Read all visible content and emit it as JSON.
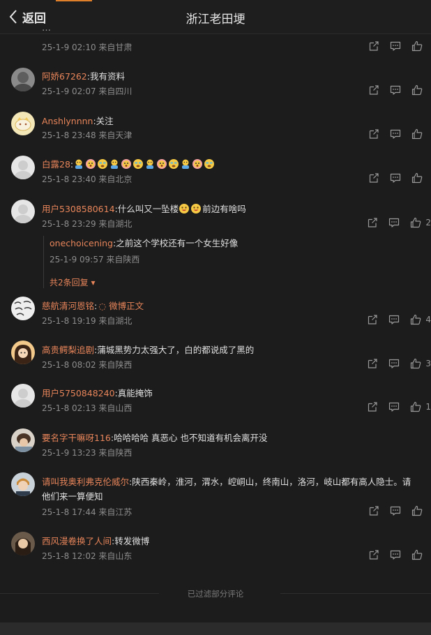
{
  "header": {
    "back_label": "返回",
    "title": "浙江老田埂"
  },
  "partial_top": {
    "text": "…"
  },
  "comments": [
    {
      "meta": "25-1-9 02:10 来自甘肃",
      "like_count": ""
    },
    {
      "user": "阿娇67262",
      "text": ":我有资料",
      "meta": "25-1-9 02:07 来自四川",
      "like_count": ""
    },
    {
      "user": "Anshlynnnn",
      "text": ":关注",
      "meta": "25-1-8 23:48 来自天津",
      "like_count": ""
    },
    {
      "user": "白露28",
      "text": ":",
      "meta": "25-1-8 23:40 来自北京",
      "like_count": ""
    },
    {
      "user": "用户5308580614",
      "text": ":什么叫又一坠楼",
      "text2": "前边有啥吗",
      "meta": "25-1-8 23:29 来自湖北",
      "like_count": "2",
      "reply": {
        "user": "onechoicening",
        "text": ":之前这个学校还有一个女生好像",
        "meta": "25-1-9 09:57 来自陕西"
      },
      "more": "共2条回复"
    },
    {
      "user": "慈航清河恩铭",
      "text": ":",
      "link": "微博正文",
      "meta": "25-1-8 19:19 来自湖北",
      "like_count": "4"
    },
    {
      "user": "高贵鳄梨追剧",
      "text": ":蒲城黑势力太强大了，白的都说成了黑的",
      "meta": "25-1-8 08:02 来自陕西",
      "like_count": "3"
    },
    {
      "user": "用户5750848240",
      "text": ":真能掩饰",
      "meta": "25-1-8 02:13 来自山西",
      "like_count": "1"
    },
    {
      "user": "要名字干嘛呀116",
      "text": ":哈哈哈哈 真恶心  也不知道有机会离开没",
      "meta": "25-1-9 13:23 来自陕西",
      "like_count": ""
    },
    {
      "user": "请叫我奥利弗克伦威尔",
      "text": ":陕西秦岭，淮河，渭水，崆峒山，终南山，洛河，岐山都有高人隐士。请",
      "text_line2": "他们来一算便知",
      "meta": "25-1-8 17:44 来自江苏",
      "like_count": ""
    },
    {
      "user": "西风漫卷换了人间",
      "text": ":转发微博",
      "meta": "25-1-8 12:02 来自山东",
      "like_count": ""
    }
  ],
  "footer": {
    "filtered": "已过滤部分评论"
  },
  "icons": {
    "share": "share-icon",
    "comment": "comment-icon",
    "like": "like-icon",
    "back": "chevron-left-icon"
  },
  "colors": {
    "username": "#e8855a",
    "background": "#1c1c1c"
  }
}
